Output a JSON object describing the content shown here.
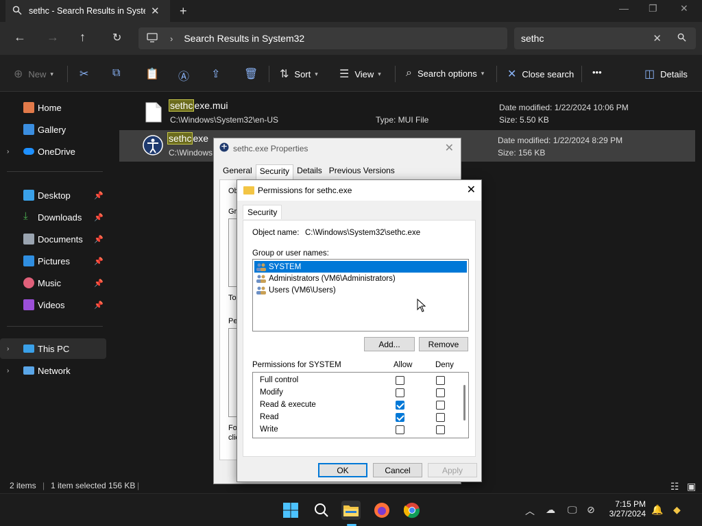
{
  "window": {
    "tab_title": "sethc - Search Results in Syster",
    "controls": {
      "minimize": "—",
      "maximize": "❐",
      "close": "✕"
    }
  },
  "address": {
    "breadcrumb": "Search Results in System32",
    "search_value": "sethc"
  },
  "commandbar": {
    "new_label": "New",
    "sort_label": "Sort",
    "view_label": "View",
    "search_options_label": "Search options",
    "close_search_label": "Close search",
    "more_label": "•••",
    "details_label": "Details"
  },
  "sidebar": {
    "items": [
      {
        "label": "Home",
        "icon": "home-icon"
      },
      {
        "label": "Gallery",
        "icon": "gallery-icon"
      },
      {
        "label": "OneDrive",
        "icon": "onedrive-icon"
      },
      {
        "label": "Desktop",
        "icon": "desktop-icon"
      },
      {
        "label": "Downloads",
        "icon": "downloads-icon"
      },
      {
        "label": "Documents",
        "icon": "documents-icon"
      },
      {
        "label": "Pictures",
        "icon": "pictures-icon"
      },
      {
        "label": "Music",
        "icon": "music-icon"
      },
      {
        "label": "Videos",
        "icon": "videos-icon"
      },
      {
        "label": "This PC",
        "icon": "this-pc-icon"
      },
      {
        "label": "Network",
        "icon": "network-icon"
      }
    ]
  },
  "files": [
    {
      "name_highlight": "sethc",
      "name_rest": "exe.mui",
      "path": "C:\\Windows\\System32\\en-US",
      "type": "Type: MUI File",
      "date": "Date modified: 1/22/2024 10:06 PM",
      "size": "Size: 5.50 KB"
    },
    {
      "name_highlight": "sethc",
      "name_rest": "exe",
      "path": "C:\\Windows",
      "type": "",
      "date": "Date modified: 1/22/2024 8:29 PM",
      "size": "Size: 156 KB"
    }
  ],
  "status": {
    "items": "2 items",
    "selected": "1 item selected  156 KB"
  },
  "properties_dialog": {
    "title": "sethc.exe Properties",
    "tabs": [
      "General",
      "Security",
      "Details",
      "Previous Versions"
    ],
    "fragments": [
      "Obj",
      "Gro",
      "To",
      "Perm",
      "For",
      "clic"
    ]
  },
  "permissions_dialog": {
    "title": "Permissions for sethc.exe",
    "tab": "Security",
    "object_label": "Object name:",
    "object_value": "C:\\Windows\\System32\\sethc.exe",
    "group_label": "Group or user names:",
    "groups": [
      "SYSTEM",
      "Administrators (VM6\\Administrators)",
      "Users (VM6\\Users)"
    ],
    "add_button": "Add...",
    "remove_button": "Remove",
    "permissions_label": "Permissions for SYSTEM",
    "allow_header": "Allow",
    "deny_header": "Deny",
    "permissions": [
      {
        "name": "Full control",
        "allow": false,
        "deny": false
      },
      {
        "name": "Modify",
        "allow": false,
        "deny": false
      },
      {
        "name": "Read & execute",
        "allow": true,
        "deny": false
      },
      {
        "name": "Read",
        "allow": true,
        "deny": false
      },
      {
        "name": "Write",
        "allow": false,
        "deny": false
      }
    ],
    "ok_button": "OK",
    "cancel_button": "Cancel",
    "apply_button": "Apply"
  },
  "taskbar": {
    "time": "7:15 PM",
    "date": "3/27/2024"
  }
}
